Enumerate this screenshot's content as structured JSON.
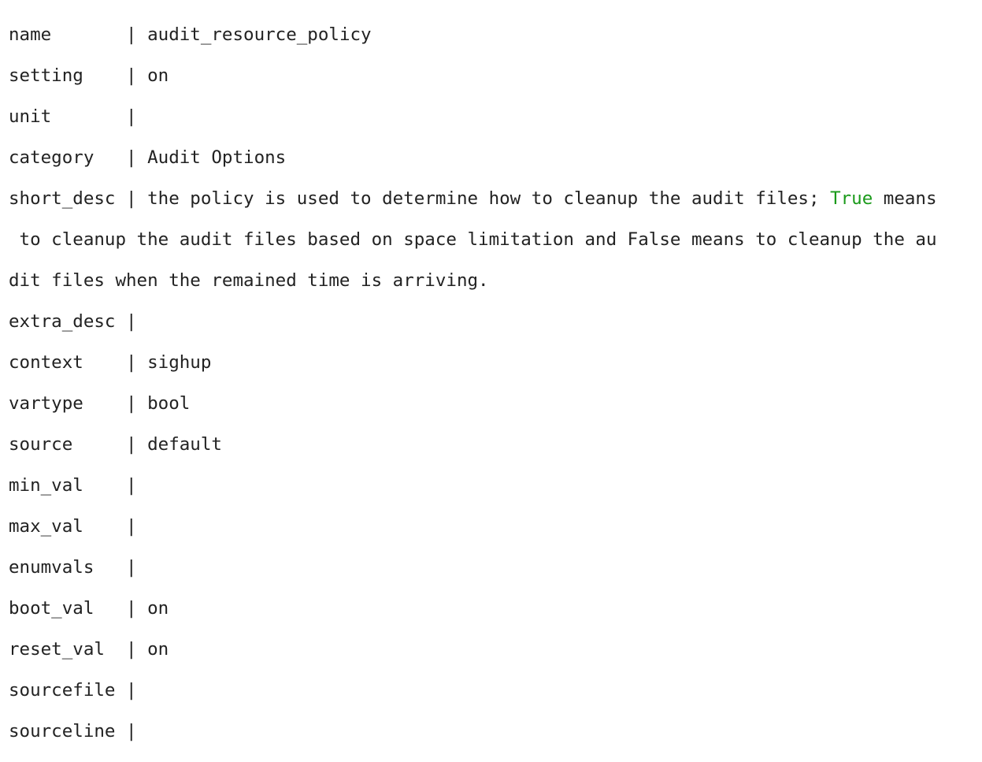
{
  "terminal": {
    "rows": [
      {
        "label": "name       ",
        "value": "audit_resource_policy"
      },
      {
        "label": "setting    ",
        "value": "on"
      },
      {
        "label": "unit       ",
        "value": ""
      },
      {
        "label": "category   ",
        "value": "Audit Options"
      },
      {
        "label": "short_desc ",
        "value_pre": "the policy is used to determine how to cleanup the audit files; ",
        "value_highlight": "True",
        "value_post": " means",
        "continuation_1": " to cleanup the audit files based on space limitation and False means to cleanup the au",
        "continuation_2": "dit files when the remained time is arriving."
      },
      {
        "label": "extra_desc ",
        "value": ""
      },
      {
        "label": "context    ",
        "value": "sighup"
      },
      {
        "label": "vartype    ",
        "value": "bool"
      },
      {
        "label": "source     ",
        "value": "default"
      },
      {
        "label": "min_val    ",
        "value": ""
      },
      {
        "label": "max_val    ",
        "value": ""
      },
      {
        "label": "enumvals   ",
        "value": ""
      },
      {
        "label": "boot_val   ",
        "value": "on"
      },
      {
        "label": "reset_val  ",
        "value": "on"
      },
      {
        "label": "sourcefile ",
        "value": ""
      },
      {
        "label": "sourceline ",
        "value": ""
      }
    ],
    "separator": "| ",
    "highlight_color": "#1a9a1a"
  }
}
